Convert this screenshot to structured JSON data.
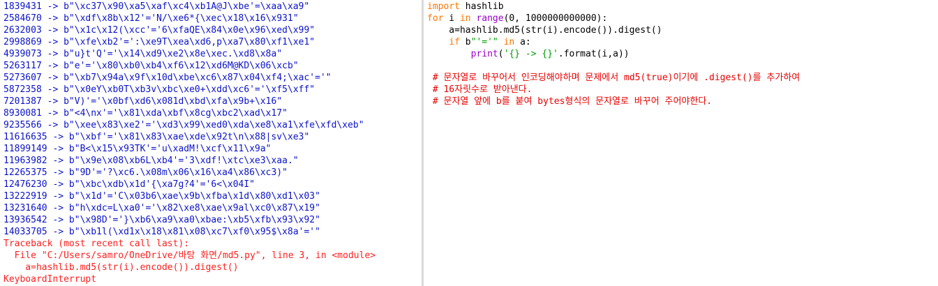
{
  "shell": {
    "output_lines": [
      "1839431 -> b\"\\xc37\\x90\\xa5\\xaf\\xc4\\xb1A@J\\xbe'=\\xaa\\xa9\"",
      "2584670 -> b\"\\xdf\\x8b\\x12'='N/\\xe6*{\\xec\\x18\\x16\\x931\"",
      "2632003 -> b\"\\x1c\\x12(\\xcc'='6\\xfaQE\\x84\\x0e\\x96\\xed\\x99\"",
      "2998869 -> b\"\\xfe\\xb2'=':\\xe9T\\xea\\xd6,p\\xa7\\x80\\xf1\\xe1\"",
      "4939073 -> b\"u}t'Q'='\\x14\\xd9\\xe2\\x8e\\xec.\\xd8\\x8a\"",
      "5263117 -> b\"e'='\\x80\\xb0\\xb4\\xf6\\x12\\xd6M@KD\\x06\\xcb\"",
      "5273607 -> b\"\\xb7\\x94a\\x9f\\x10d\\xbe\\xc6\\x87\\x04\\xf4;\\xac'='\"",
      "5872358 -> b\"\\x0eY\\xb0T\\xb3v\\xbc\\xe0+\\xdd\\xc6'='\\xf5\\xff\"",
      "7201387 -> b\"V)'='\\x0bf\\xd6\\x081d\\xbd\\xfa\\x9b+\\x16\"",
      "8930081 -> b\"<4\\nx'='\\x81\\xda\\xbf\\x8cg\\xbc2\\xad\\x17\"",
      "9235566 -> b\"\\xee\\x83\\xe2'='\\xd3\\x99\\xed0\\xda\\xe8\\xa1\\xfe\\xfd\\xeb\"",
      "11616635 -> b\"\\xbf'='\\x81\\x83\\xae\\xde\\x92t\\n\\x88|sv\\xe3\"",
      "11899149 -> b\"B<\\x15\\x93TK'='u\\xadM!\\xcf\\x11\\x9a\"",
      "11963982 -> b\"\\x9e\\x08\\xb6L\\xb4'='3\\xdf!\\xtc\\xe3\\xaa.\"",
      "12265375 -> b\"9D'='?\\xc6.\\x08m\\x06\\x16\\xa4\\x86\\xc3)\"",
      "12476230 -> b\"\\xbc\\xdb\\x1d'{\\xa7g?4'='6<\\x04I\"",
      "13222919 -> b\"\\x1d'='C\\x03b6\\xae\\x9b\\xfba\\x1d\\x80\\xd1\\x03\"",
      "13231640 -> b\"h\\xdc=L\\xa0'='\\x82\\xe8\\xae\\x9al\\xc0\\x87\\x19\"",
      "13936542 -> b\"\\x98D'='}\\xb6\\xa9\\xa0\\xbae:\\xb5\\xfb\\x93\\x92\"",
      "14033705 -> b\"\\xb1l(\\xd1x\\x18\\x81\\x08\\xc7\\xf0\\x95$\\x8a'='\""
    ],
    "traceback_lines": [
      "Traceback (most recent call last):",
      "  File \"C:/Users/samro/OneDrive/바탕 화면/md5.py\", line 3, in <module>",
      "    a=hashlib.md5(str(i).encode()).digest()",
      "KeyboardInterrupt"
    ]
  },
  "editor": {
    "code": {
      "l1_kw": "import",
      "l1_rest": " hashlib",
      "l2_kw1": "for",
      "l2_mid": " i ",
      "l2_kw2": "in",
      "l2_sp": " ",
      "l2_bi": "range",
      "l2_rest": "(0, 1000000000000):",
      "l3": "    a=hashlib.md5(str(i).encode()).digest()",
      "l4_indent": "    ",
      "l4_kw1": "if",
      "l4_sp1": " b",
      "l4_str": "\"'='\"",
      "l4_sp2": " ",
      "l4_kw2": "in",
      "l4_rest": " a:",
      "l5_indent": "        ",
      "l5_bi": "print",
      "l5_open": "(",
      "l5_str": "'{} -> {}'",
      "l5_rest": ".format(i,a))"
    },
    "comments": [
      " # 문자열로 바꾸어서 인코딩해야하며 문제에서 md5(true)이기에 .digest()를 추가하여",
      " # 16자릿수로 받아낸다.",
      " # 문자열 앞에 b를 붙여 bytes형식의 문자열로 바꾸어 주어야한다."
    ]
  },
  "colors": {
    "output": "#0b12c8",
    "error": "#ff1e1e",
    "keyword": "#ff7700",
    "builtin": "#9900cc",
    "string": "#00a000",
    "comment": "#e80000"
  }
}
